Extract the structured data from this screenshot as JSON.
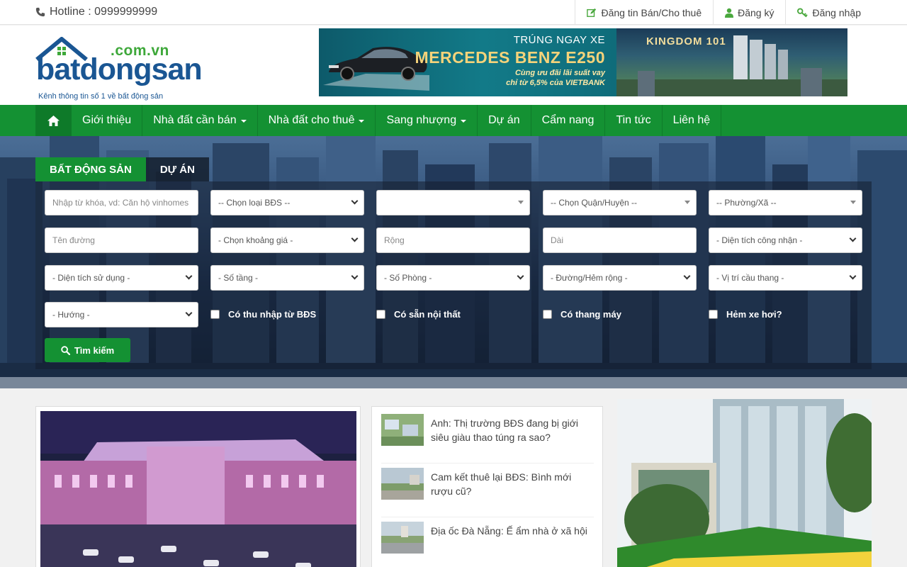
{
  "topbar": {
    "hotline": "Hotline : 0999999999",
    "links": [
      {
        "label": "Đăng tin Bán/Cho thuê",
        "icon": "edit-icon"
      },
      {
        "label": "Đăng ký",
        "icon": "user-icon"
      },
      {
        "label": "Đăng nhập",
        "icon": "key-icon"
      }
    ]
  },
  "logo": {
    "dotcom": ".com.vn",
    "word": "batdongsan",
    "tagline": "Kênh thông tin số 1 về bất động sản"
  },
  "banner": {
    "line1": "TRÚNG NGAY XE",
    "line2": "MERCEDES BENZ E250",
    "line3": "Cùng ưu đãi lãi suất vay",
    "line4": "chỉ từ 6,5% của VIETBANK",
    "kingdom": "KINGDOM 101"
  },
  "nav": {
    "items": [
      {
        "label": "Giới thiệu",
        "dropdown": false
      },
      {
        "label": "Nhà đất cần bán",
        "dropdown": true
      },
      {
        "label": "Nhà đất cho thuê",
        "dropdown": true
      },
      {
        "label": "Sang nhượng",
        "dropdown": true
      },
      {
        "label": "Dự án",
        "dropdown": false
      },
      {
        "label": "Cẩm nang",
        "dropdown": false
      },
      {
        "label": "Tin tức",
        "dropdown": false
      },
      {
        "label": "Liên hệ",
        "dropdown": false
      }
    ]
  },
  "search": {
    "tabs": [
      "BẤT ĐỘNG SẢN",
      "DỰ ÁN"
    ],
    "keyword_placeholder": "Nhập từ khóa, vd: Căn hộ vinhomes",
    "type_select": "-- Chọn loại BĐS --",
    "city_select": "",
    "district_select": "-- Chọn Quận/Huyện --",
    "ward_select": "-- Phường/Xã --",
    "street_placeholder": "Tên đường",
    "price_select": "- Chọn khoảng giá -",
    "width_placeholder": "Rộng",
    "length_placeholder": "Dài",
    "area_recognized_select": "- Diện tích công nhận -",
    "area_used_select": "- Diện tích sử dụng -",
    "floors_select": "- Số tầng -",
    "rooms_select": "- Số Phòng -",
    "road_select": "- Đường/Hẻm rộng -",
    "stair_select": "- Vị trí cầu thang -",
    "direction_select": "- Hướng -",
    "checks": [
      "Có thu nhập từ BĐS",
      "Có sẵn nội thất",
      "Có thang máy",
      "Hẻm xe hơi?"
    ],
    "button_label": "Tìm kiếm"
  },
  "news": [
    "Anh: Thị trường BĐS đang bị giới siêu giàu thao túng ra sao?",
    "Cam kết thuê lại BĐS: Bình mới rượu cũ?",
    "Địa ốc Đà Nẵng: Ế ẩm nhà ở xã hội"
  ],
  "colors": {
    "brand_green": "#149133",
    "logo_blue": "#1a5693",
    "logo_green": "#3ea83a"
  }
}
